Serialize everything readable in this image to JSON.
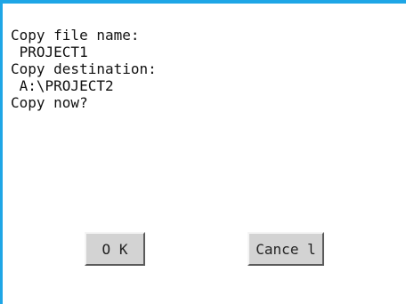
{
  "dialog": {
    "lines": [
      "Copy file name:",
      " PROJECT1",
      "Copy destination:",
      " A:\\PROJECT2",
      "Copy now?"
    ],
    "ok_label": "O K",
    "cancel_label": "Cance l"
  },
  "colors": {
    "frame": "#1ea6e6",
    "button_face": "#d3d3d3"
  }
}
